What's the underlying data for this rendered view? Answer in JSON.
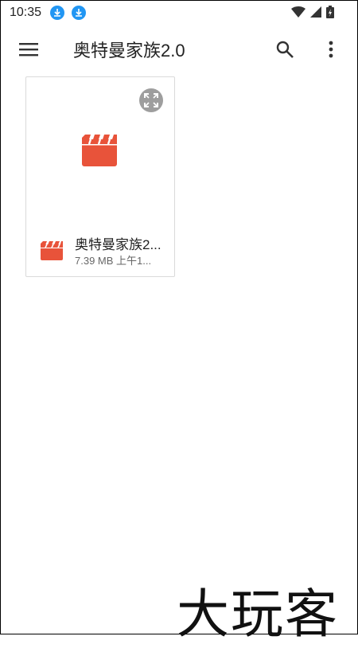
{
  "status_bar": {
    "time": "10:35",
    "download_icons": [
      "download-icon",
      "download-icon"
    ],
    "wifi_icon": "wifi-icon",
    "signal_icon": "signal-icon",
    "battery_icon": "battery-charging-icon"
  },
  "app_bar": {
    "menu_icon": "menu-icon",
    "title": "奥特曼家族2.0",
    "search_icon": "search-icon",
    "more_icon": "more-vert-icon"
  },
  "files": [
    {
      "name": "奥特曼家族2...",
      "meta": "7.39 MB 上午1...",
      "type_icon": "video-clapperboard-icon",
      "expand_icon": "expand-icon"
    }
  ],
  "watermark": "大玩客",
  "colors": {
    "accent_blue": "#2196f3",
    "video_red": "#e8533a",
    "icon_gray": "#9e9e9e"
  }
}
